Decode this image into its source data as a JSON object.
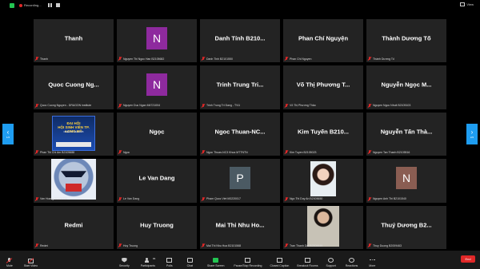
{
  "topbar": {
    "recording_label": "Recording...",
    "view_label": "View"
  },
  "nav": {
    "page_left": "1/4",
    "page_right": "2/4",
    "left_arrow": "‹",
    "right_arrow": "›"
  },
  "tiles": [
    {
      "kind": "name",
      "big": "Thanh",
      "small": "Thanh"
    },
    {
      "kind": "avatar",
      "letter": "N",
      "color": "#8e2a9e",
      "small": "Nguyen Thi Ngoc Han B2105682"
    },
    {
      "kind": "name",
      "big": "Danh Tính B210...",
      "small": "Danh Tinh B2101550"
    },
    {
      "kind": "name",
      "big": "Phan Chí Nguyện",
      "small": "Phan Chi Nguyen"
    },
    {
      "kind": "name",
      "big": "Thành Dương Tố",
      "small": "Thành Dương Tố"
    },
    {
      "kind": "name",
      "big": "Quoc Cuong Ng...",
      "small": "Quoc Cuong Nguyen - DRAGON institute"
    },
    {
      "kind": "avatar",
      "letter": "N",
      "color": "#8e2a9e",
      "small": "Nguyen Duc Ngan M4721004"
    },
    {
      "kind": "name",
      "big": "Trinh Trung Tri...",
      "small": "Trinh Trung Tri Dang - TVU"
    },
    {
      "kind": "name",
      "big": "Võ Thị Phương T...",
      "small": "Võ Thị Phương Thảo"
    },
    {
      "kind": "name",
      "big": "Nguyễn Ngọc M...",
      "small": "Nguyen Ngoc Nhuit B2105103"
    },
    {
      "kind": "poster",
      "poster_title": "ĐẠI HỘI\nHỘI SINH VIÊN TP. LONG MỸ",
      "poster_sub": "NHIỆM KỲ 2022-2025",
      "small": "Phan Thi Chi Am B2105688"
    },
    {
      "kind": "name",
      "big": "Ngọc",
      "small": "Ngoc"
    },
    {
      "kind": "name",
      "big": "Ngoc Thuan-NC...",
      "small": "Ngoc Thuan-NC3 Khoa MTTNTN"
    },
    {
      "kind": "name",
      "big": "Kim Tuyến B210...",
      "small": "Kim Tuyen B2105023"
    },
    {
      "kind": "name",
      "big": "Nguyễn Tấn Thà...",
      "small": "Nguyen Tan Thanh B2105516"
    },
    {
      "kind": "robot",
      "small": "Van Hoang B2102220"
    },
    {
      "kind": "name",
      "big": "Le Van Dang",
      "small": "Le Van Dang"
    },
    {
      "kind": "avatar",
      "letter": "P",
      "color": "#4b5a63",
      "small": "Pham Quoc Viet M3220017"
    },
    {
      "kind": "girl",
      "small": "Ngo Thi Duy An B2005650"
    },
    {
      "kind": "avatar",
      "letter": "N",
      "color": "#8a5d52",
      "small": "Nguyen Anh Thi B2101540"
    },
    {
      "kind": "name",
      "big": "Redmi",
      "small": "Redmi"
    },
    {
      "kind": "name",
      "big": "Huy Truong",
      "small": "Huy Truong"
    },
    {
      "kind": "name",
      "big": "Mai Thi Nhu Ho...",
      "small": "Mai Thi Nhu Hoa B2101568"
    },
    {
      "kind": "man",
      "small": "Tran Thanh Dat B2104449"
    },
    {
      "kind": "name",
      "big": "Thuý Dương B2...",
      "small": "Thuy Duong B2009463"
    }
  ],
  "toolbar": {
    "mute": "Mute",
    "start_video": "Start Video",
    "security": "Security",
    "participants": "Participants",
    "participants_count": "86",
    "polls": "Polls",
    "chat": "Chat",
    "share_screen": "Share Screen",
    "pause_stop_recording": "Pause/Stop Recording",
    "closed_caption": "Closed Caption",
    "breakout_rooms": "Breakout Rooms",
    "support": "Support",
    "reactions": "Reactions",
    "more": "More",
    "end": "End"
  }
}
